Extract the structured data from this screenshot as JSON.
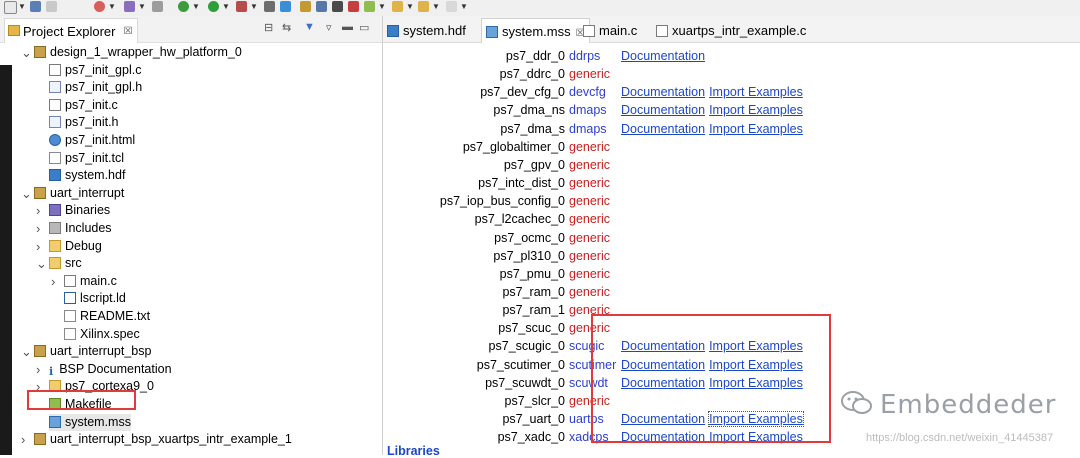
{
  "project_explorer": {
    "title": "Project Explorer",
    "close_glyph": "☒",
    "tree": [
      {
        "label": "design_1_wrapper_hw_platform_0",
        "level": 0,
        "twisty": "open",
        "icon": "project-icon"
      },
      {
        "label": "ps7_init_gpl.c",
        "level": 1,
        "twisty": "",
        "icon": "c-file-icon"
      },
      {
        "label": "ps7_init_gpl.h",
        "level": 1,
        "twisty": "",
        "icon": "h-file-icon"
      },
      {
        "label": "ps7_init.c",
        "level": 1,
        "twisty": "",
        "icon": "c-file-icon"
      },
      {
        "label": "ps7_init.h",
        "level": 1,
        "twisty": "",
        "icon": "h-file-icon"
      },
      {
        "label": "ps7_init.html",
        "level": 1,
        "twisty": "",
        "icon": "web-file-icon"
      },
      {
        "label": "ps7_init.tcl",
        "level": 1,
        "twisty": "",
        "icon": "text-file-icon"
      },
      {
        "label": "system.hdf",
        "level": 1,
        "twisty": "",
        "icon": "hdf-file-icon"
      },
      {
        "label": "uart_interrupt",
        "level": 0,
        "twisty": "open",
        "icon": "project-icon"
      },
      {
        "label": "Binaries",
        "level": 1,
        "twisty": "closed",
        "icon": "binaries-icon"
      },
      {
        "label": "Includes",
        "level": 1,
        "twisty": "closed",
        "icon": "includes-icon"
      },
      {
        "label": "Debug",
        "level": 1,
        "twisty": "closed",
        "icon": "folder-icon"
      },
      {
        "label": "src",
        "level": 1,
        "twisty": "open",
        "icon": "folder-icon"
      },
      {
        "label": "main.c",
        "level": 2,
        "twisty": "closed",
        "icon": "c-file-icon"
      },
      {
        "label": "lscript.ld",
        "level": 2,
        "twisty": "",
        "icon": "linker-script-icon"
      },
      {
        "label": "README.txt",
        "level": 2,
        "twisty": "",
        "icon": "text-file-icon"
      },
      {
        "label": "Xilinx.spec",
        "level": 2,
        "twisty": "",
        "icon": "text-file-icon"
      },
      {
        "label": "uart_interrupt_bsp",
        "level": 0,
        "twisty": "open",
        "icon": "bsp-project-icon"
      },
      {
        "label": "BSP Documentation",
        "level": 1,
        "twisty": "closed",
        "icon": "info-icon"
      },
      {
        "label": "ps7_cortexa9_0",
        "level": 1,
        "twisty": "closed",
        "icon": "folder-icon"
      },
      {
        "label": "Makefile",
        "level": 1,
        "twisty": "",
        "icon": "makefile-icon"
      },
      {
        "label": "system.mss",
        "level": 1,
        "twisty": "",
        "icon": "mss-file-icon",
        "selected": true
      },
      {
        "label": "uart_interrupt_bsp_xuartps_intr_example_1",
        "level": 0,
        "twisty": "closed",
        "icon": "project-icon"
      }
    ]
  },
  "editor": {
    "tabs": [
      {
        "label": "system.hdf",
        "icon": "hdf-file-icon",
        "active": false
      },
      {
        "label": "system.mss",
        "icon": "mss-file-icon",
        "active": true,
        "close_glyph": "☒"
      },
      {
        "label": "main.c",
        "icon": "c-file-icon",
        "active": false
      },
      {
        "label": "xuartps_intr_example.c",
        "icon": "c-file-icon",
        "active": false
      }
    ],
    "peripherals": [
      {
        "name": "ps7_ddr_0",
        "driver": "ddrps",
        "driver_color": "blue",
        "links": [
          "Documentation"
        ]
      },
      {
        "name": "ps7_ddrc_0",
        "driver": "generic",
        "driver_color": "red",
        "links": []
      },
      {
        "name": "ps7_dev_cfg_0",
        "driver": "devcfg",
        "driver_color": "blue",
        "links": [
          "Documentation",
          "Import Examples"
        ]
      },
      {
        "name": "ps7_dma_ns",
        "driver": "dmaps",
        "driver_color": "blue",
        "links": [
          "Documentation",
          "Import Examples"
        ]
      },
      {
        "name": "ps7_dma_s",
        "driver": "dmaps",
        "driver_color": "blue",
        "links": [
          "Documentation",
          "Import Examples"
        ]
      },
      {
        "name": "ps7_globaltimer_0",
        "driver": "generic",
        "driver_color": "red",
        "links": []
      },
      {
        "name": "ps7_gpv_0",
        "driver": "generic",
        "driver_color": "red",
        "links": []
      },
      {
        "name": "ps7_intc_dist_0",
        "driver": "generic",
        "driver_color": "red",
        "links": []
      },
      {
        "name": "ps7_iop_bus_config_0",
        "driver": "generic",
        "driver_color": "red",
        "links": []
      },
      {
        "name": "ps7_l2cachec_0",
        "driver": "generic",
        "driver_color": "red",
        "links": []
      },
      {
        "name": "ps7_ocmc_0",
        "driver": "generic",
        "driver_color": "red",
        "links": []
      },
      {
        "name": "ps7_pl310_0",
        "driver": "generic",
        "driver_color": "red",
        "links": []
      },
      {
        "name": "ps7_pmu_0",
        "driver": "generic",
        "driver_color": "red",
        "links": []
      },
      {
        "name": "ps7_ram_0",
        "driver": "generic",
        "driver_color": "red",
        "links": []
      },
      {
        "name": "ps7_ram_1",
        "driver": "generic",
        "driver_color": "red",
        "links": []
      },
      {
        "name": "ps7_scuc_0",
        "driver": "generic",
        "driver_color": "red",
        "links": []
      },
      {
        "name": "ps7_scugic_0",
        "driver": "scugic",
        "driver_color": "blue",
        "links": [
          "Documentation",
          "Import Examples"
        ]
      },
      {
        "name": "ps7_scutimer_0",
        "driver": "scutimer",
        "driver_color": "blue",
        "links": [
          "Documentation",
          "Import Examples"
        ]
      },
      {
        "name": "ps7_scuwdt_0",
        "driver": "scuwdt",
        "driver_color": "blue",
        "links": [
          "Documentation",
          "Import Examples"
        ]
      },
      {
        "name": "ps7_slcr_0",
        "driver": "generic",
        "driver_color": "red",
        "links": []
      },
      {
        "name": "ps7_uart_0",
        "driver": "uartps",
        "driver_color": "blue",
        "links": [
          "Documentation",
          "Import Examples"
        ],
        "focused_link": 1
      },
      {
        "name": "ps7_xadc_0",
        "driver": "xadcps",
        "driver_color": "blue",
        "links": [
          "Documentation",
          "Import Examples"
        ]
      }
    ],
    "libraries_heading": "Libraries"
  },
  "watermark": {
    "brand": "Embeddeder",
    "url": "https://blog.csdn.net/weixin_41445387"
  },
  "colors": {
    "annotation_red": "#e23a3a",
    "link_blue": "#1c48c6",
    "driver_blue": "#2b3fd0",
    "generic_red": "#c81e1e"
  }
}
